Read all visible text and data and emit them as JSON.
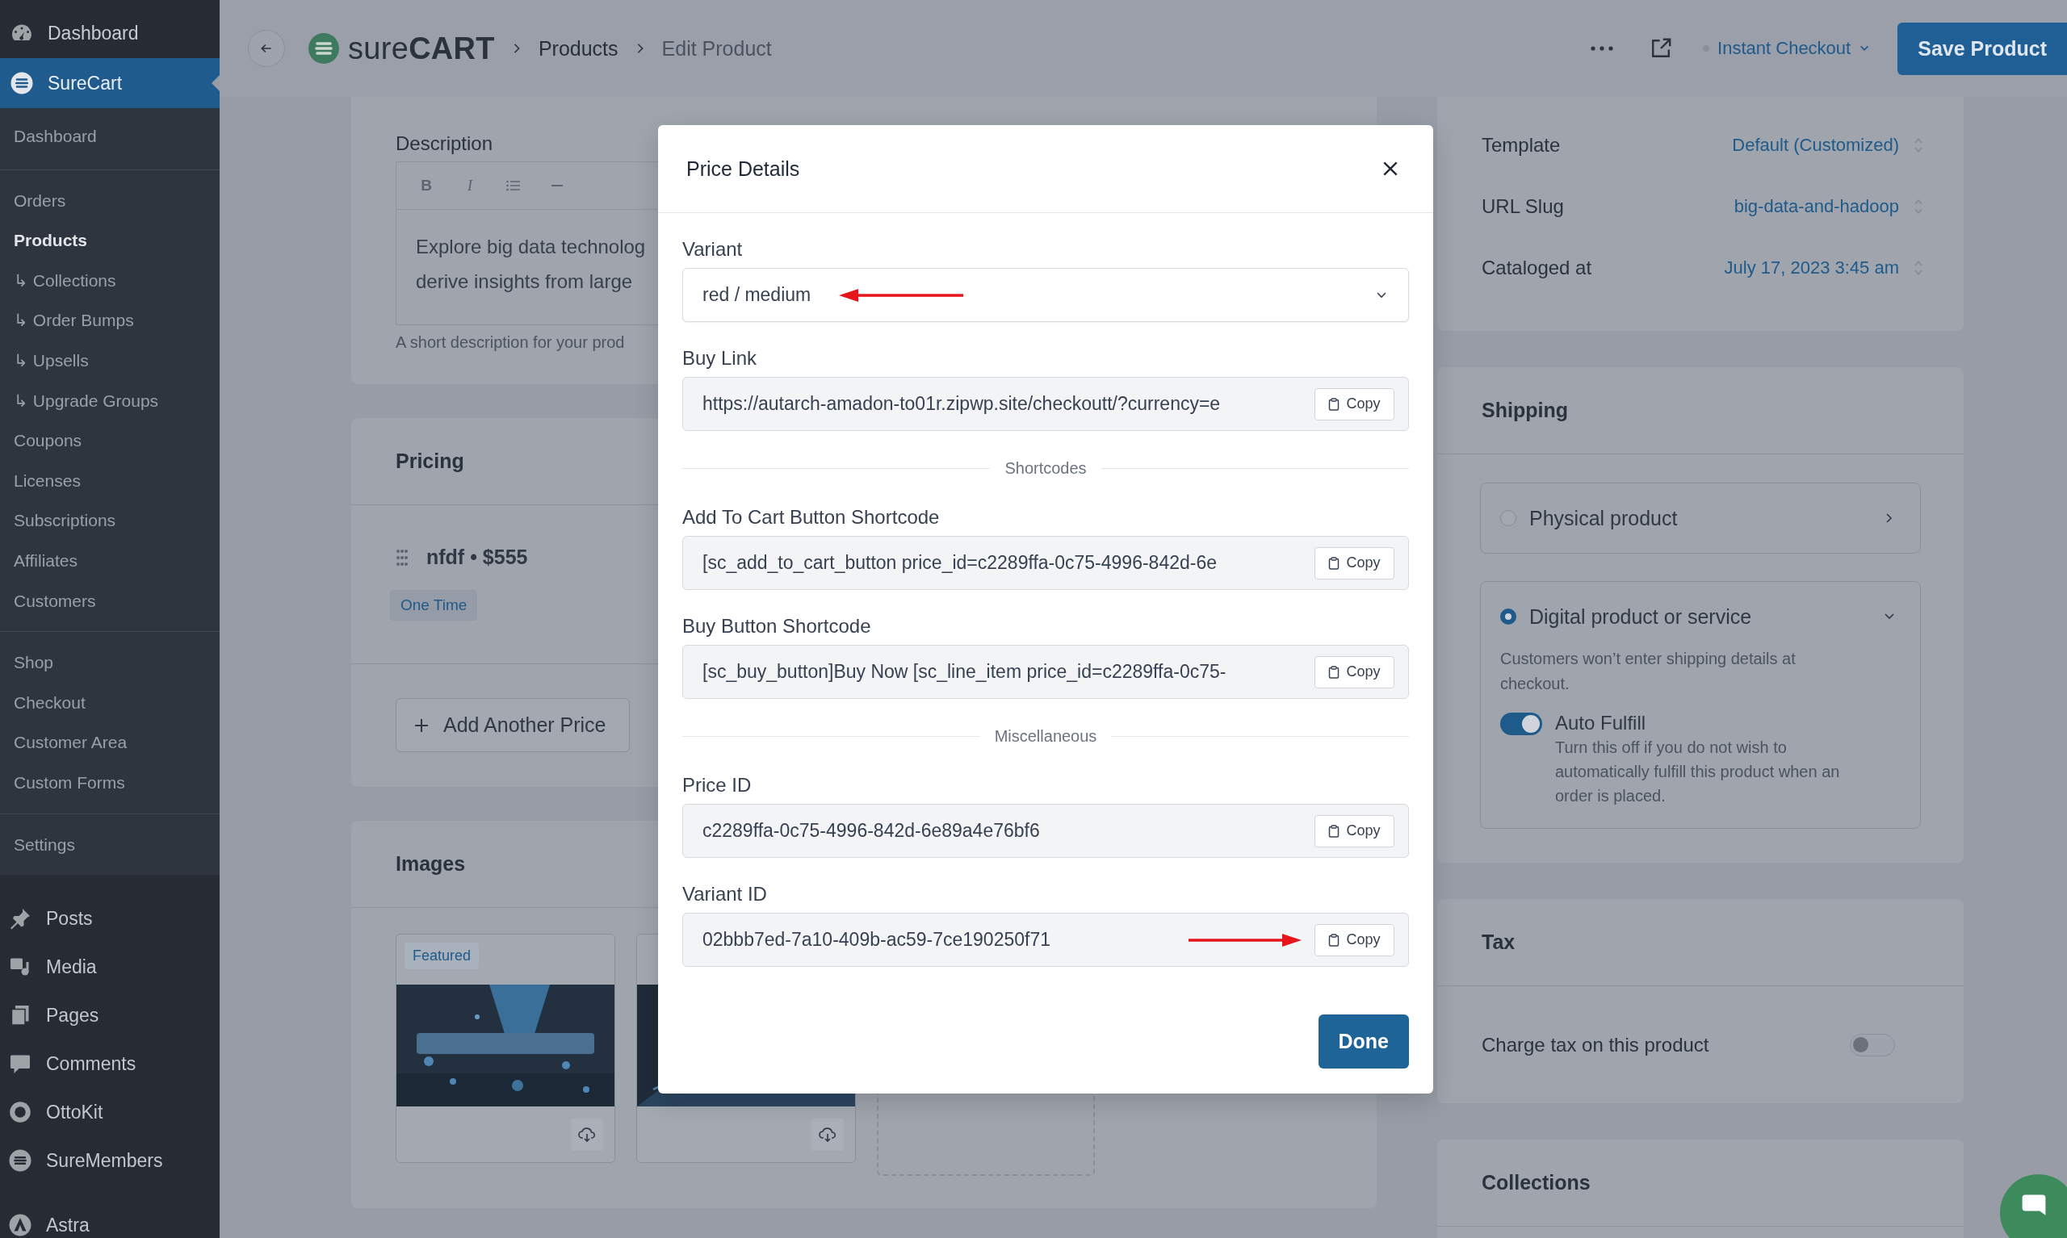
{
  "sidebar": {
    "top_items": [
      {
        "label": "Dashboard",
        "selected": false
      },
      {
        "label": "SureCart",
        "selected": true
      }
    ],
    "submenu_groups": [
      [
        {
          "label": "Dashboard",
          "selected": false
        }
      ],
      [
        {
          "label": "Orders",
          "selected": false
        },
        {
          "label": "Products",
          "selected": true
        },
        {
          "label": "↳ Collections",
          "selected": false
        },
        {
          "label": "↳ Order Bumps",
          "selected": false
        },
        {
          "label": "↳ Upsells",
          "selected": false
        },
        {
          "label": "↳ Upgrade Groups",
          "selected": false
        },
        {
          "label": "Coupons",
          "selected": false
        },
        {
          "label": "Licenses",
          "selected": false
        },
        {
          "label": "Subscriptions",
          "selected": false
        },
        {
          "label": "Affiliates",
          "selected": false
        },
        {
          "label": "Customers",
          "selected": false
        }
      ],
      [
        {
          "label": "Shop",
          "selected": false
        },
        {
          "label": "Checkout",
          "selected": false
        },
        {
          "label": "Customer Area",
          "selected": false
        },
        {
          "label": "Custom Forms",
          "selected": false
        }
      ],
      [
        {
          "label": "Settings",
          "selected": false
        }
      ]
    ],
    "bottom_groups": [
      [
        {
          "label": "Posts"
        },
        {
          "label": "Media"
        },
        {
          "label": "Pages"
        },
        {
          "label": "Comments"
        },
        {
          "label": "OttoKit"
        },
        {
          "label": "SureMembers"
        }
      ],
      [
        {
          "label": "Astra"
        }
      ]
    ]
  },
  "header": {
    "logo": "sure**CART**",
    "breadcrumbs": [
      {
        "label": "Products",
        "current": false
      },
      {
        "label": "Edit Product",
        "current": true
      }
    ],
    "checkout_menu": "Instant Checkout",
    "save_button": "Save Product"
  },
  "description": {
    "label": "Description",
    "toolbar": [
      {
        "kind": "bold",
        "label": "B"
      },
      {
        "kind": "italic",
        "label": "I"
      },
      {
        "kind": "list"
      },
      {
        "kind": "rule"
      }
    ],
    "lines": [
      "Explore big data technolog",
      "derive insights from large"
    ],
    "help": "A short description for your prod"
  },
  "pricing": {
    "title": "Pricing",
    "prices": [
      {
        "name": "nfdf • $555",
        "badge": "One Time"
      }
    ],
    "add_button": "Add Another Price"
  },
  "images": {
    "title": "Images",
    "items": [
      {
        "kind": "picture",
        "badge": "Featured"
      },
      {
        "kind": "picture"
      }
    ]
  },
  "product_settings": [
    {
      "label": "Template",
      "value": "Default (Customized)"
    },
    {
      "label": "URL Slug",
      "value": "big-data-and-hadoop"
    },
    {
      "label": "Cataloged at",
      "value": "July 17, 2023 3:45 am"
    }
  ],
  "shipping": {
    "title": "Shipping",
    "options": [
      {
        "label": "Physical product",
        "selected": false,
        "expanded": false
      },
      {
        "label": "Digital product or service",
        "selected": true,
        "expanded": true,
        "description": "Customers won’t enter shipping details at checkout.",
        "toggle": {
          "label": "Auto Fulfill",
          "on": true,
          "help": "Turn this off if you do not wish to automatically fulfill this product when an order is placed."
        }
      }
    ]
  },
  "tax": {
    "title": "Tax",
    "label": "Charge tax on this product",
    "on": false
  },
  "collections": {
    "title": "Collections"
  },
  "modal": {
    "title": "Price Details",
    "items": [
      {
        "kind": "select",
        "label": "Variant",
        "value": "red / medium",
        "annotated": true
      },
      {
        "kind": "copy",
        "label": "Buy Link",
        "value": "https://autarch-amadon-to01r.zipwp.site/checkoutt/?currency=e",
        "button": "Copy",
        "annotated": false
      },
      {
        "kind": "divider",
        "label": "Shortcodes"
      },
      {
        "kind": "copy",
        "label": "Add To Cart Button Shortcode",
        "value": "[sc_add_to_cart_button price_id=c2289ffa-0c75-4996-842d-6e",
        "button": "Copy",
        "annotated": false
      },
      {
        "kind": "copy",
        "label": "Buy Button Shortcode",
        "value": "[sc_buy_button]Buy Now [sc_line_item price_id=c2289ffa-0c75-",
        "button": "Copy",
        "annotated": false
      },
      {
        "kind": "divider",
        "label": "Miscellaneous"
      },
      {
        "kind": "copy",
        "label": "Price ID",
        "value": "c2289ffa-0c75-4996-842d-6e89a4e76bf6",
        "button": "Copy",
        "annotated": false
      },
      {
        "kind": "copy",
        "label": "Variant ID",
        "value": "02bbb7ed-7a10-409b-ac59-7ce190250f71",
        "button": "Copy",
        "annotated": true
      }
    ],
    "done_button": "Done"
  }
}
